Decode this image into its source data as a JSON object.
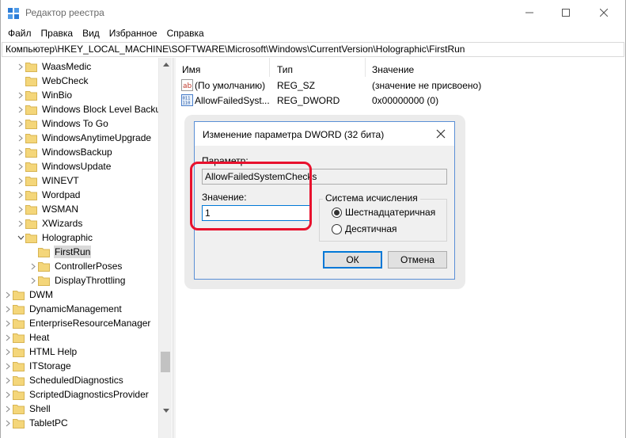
{
  "window": {
    "title": "Редактор реестра",
    "icon": "registry-editor-icon"
  },
  "menu": [
    "Файл",
    "Правка",
    "Вид",
    "Избранное",
    "Справка"
  ],
  "address": "Компьютер\\HKEY_LOCAL_MACHINE\\SOFTWARE\\Microsoft\\Windows\\CurrentVersion\\Holographic\\FirstRun",
  "tree": {
    "items": [
      {
        "label": "WaasMedic",
        "expander": "collapsed"
      },
      {
        "label": "WebCheck",
        "expander": "none"
      },
      {
        "label": "WinBio",
        "expander": "collapsed"
      },
      {
        "label": "Windows Block Level Backu",
        "expander": "collapsed"
      },
      {
        "label": "Windows To Go",
        "expander": "collapsed"
      },
      {
        "label": "WindowsAnytimeUpgrade",
        "expander": "collapsed"
      },
      {
        "label": "WindowsBackup",
        "expander": "collapsed"
      },
      {
        "label": "WindowsUpdate",
        "expander": "collapsed"
      },
      {
        "label": "WINEVT",
        "expander": "collapsed"
      },
      {
        "label": "Wordpad",
        "expander": "collapsed"
      },
      {
        "label": "WSMAN",
        "expander": "collapsed"
      },
      {
        "label": "XWizards",
        "expander": "collapsed"
      },
      {
        "label": "Holographic",
        "expander": "expanded"
      },
      {
        "label": "FirstRun",
        "expander": "none",
        "selected": true
      },
      {
        "label": "ControllerPoses",
        "expander": "collapsed"
      },
      {
        "label": "DisplayThrottling",
        "expander": "collapsed"
      },
      {
        "label": "DWM",
        "expander": "collapsed"
      },
      {
        "label": "DynamicManagement",
        "expander": "collapsed"
      },
      {
        "label": "EnterpriseResourceManager",
        "expander": "collapsed"
      },
      {
        "label": "Heat",
        "expander": "collapsed"
      },
      {
        "label": "HTML Help",
        "expander": "collapsed"
      },
      {
        "label": "ITStorage",
        "expander": "collapsed"
      },
      {
        "label": "ScheduledDiagnostics",
        "expander": "collapsed"
      },
      {
        "label": "ScriptedDiagnosticsProvider",
        "expander": "collapsed"
      },
      {
        "label": "Shell",
        "expander": "collapsed"
      },
      {
        "label": "TabletPC",
        "expander": "collapsed"
      }
    ]
  },
  "values": {
    "headers": {
      "name": "Имя",
      "type": "Тип",
      "value": "Значение"
    },
    "rows": [
      {
        "icon": "string-value-icon",
        "name": "(По умолчанию)",
        "type": "REG_SZ",
        "value": "(значение не присвоено)"
      },
      {
        "icon": "binary-value-icon",
        "name": "AllowFailedSyst...",
        "type": "REG_DWORD",
        "value": "0x00000000 (0)"
      }
    ]
  },
  "dialog": {
    "title": "Изменение параметра DWORD (32 бита)",
    "param_label": "Параметр:",
    "param_value": "AllowFailedSystemChecks",
    "value_label": "Значение:",
    "value_input": "1",
    "base_group": "Система исчисления",
    "radio_hex": "Шестнадцатеричная",
    "radio_dec": "Десятичная",
    "selected_base": "hex",
    "ok": "ОК",
    "cancel": "Отмена"
  },
  "colors": {
    "highlight": "#e8112d",
    "folder": "#f4d67a",
    "accent": "#0078d7"
  }
}
